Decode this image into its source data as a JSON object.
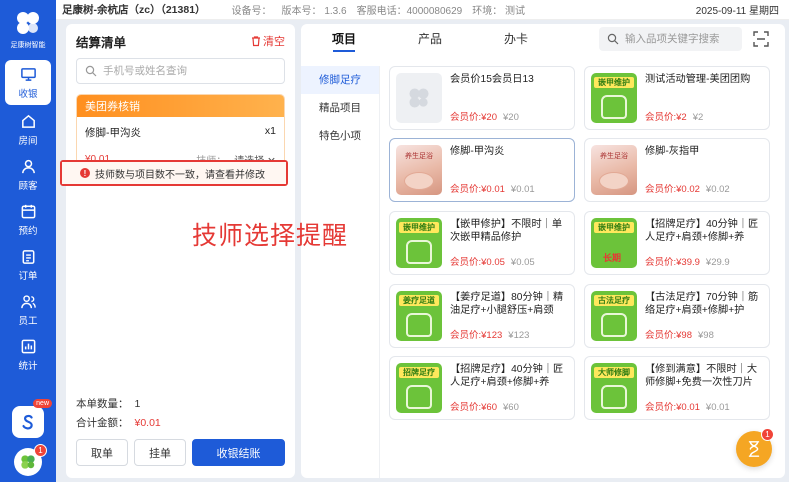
{
  "status": {
    "store": "足康树-余杭店（zc）（21381）",
    "device_label": "设备号：",
    "version": "版本号： 1.3.6",
    "hotline": "客服电话：4000080629",
    "env": "环境： 测试",
    "date": "2025-09-11 星期四"
  },
  "sidebar": {
    "logo_text": "足康树智能",
    "items": [
      {
        "label": "收银",
        "icon": "monitor-icon"
      },
      {
        "label": "房间",
        "icon": "home-icon"
      },
      {
        "label": "顾客",
        "icon": "user-icon"
      },
      {
        "label": "预约",
        "icon": "calendar-icon"
      },
      {
        "label": "订单",
        "icon": "clipboard-icon"
      },
      {
        "label": "员工",
        "icon": "group-icon"
      },
      {
        "label": "统计",
        "icon": "stats-icon"
      }
    ],
    "app_badge": "new",
    "avatar_badge": "1"
  },
  "checkout": {
    "title": "结算清单",
    "clear": "清空",
    "search_placeholder": "手机号或姓名查询",
    "coupon_title": "美团券核销",
    "item": {
      "name": "修脚-甲沟炎",
      "qty": "x1",
      "price": "¥0.01",
      "tech_label": "技师：",
      "tech_select": "请选择"
    },
    "warning": "技师数与项目数不一致，请查看并修改",
    "count_label": "本单数量：",
    "count_value": "1",
    "total_label": "合计金额：",
    "total_value": "¥0.01",
    "btn_cancel": "取单",
    "btn_hold": "挂单",
    "btn_pay": "收银结账"
  },
  "products": {
    "tabs": [
      "项目",
      "产品",
      "办卡"
    ],
    "search_placeholder": "输入品项关键字搜索",
    "categories": [
      "修脚足疗",
      "精品项目",
      "特色小项"
    ],
    "cards": [
      {
        "name": "会员价15会员日13",
        "member": "会员价:¥20",
        "orig": "¥20",
        "thumb": "gray",
        "tag": ""
      },
      {
        "name": "测试活动管理-美团团购",
        "member": "会员价:¥2",
        "orig": "¥2",
        "thumb": "green",
        "tag": "嵌甲维护"
      },
      {
        "name": "修脚-甲沟炎",
        "member": "会员价:¥0.01",
        "orig": "¥0.01",
        "thumb": "photo",
        "tag": "养生足浴"
      },
      {
        "name": "修脚-灰指甲",
        "member": "会员价:¥0.02",
        "orig": "¥0.02",
        "thumb": "photo",
        "tag": "养生足浴"
      },
      {
        "name": "【嵌甲修护】不限时｜单次嵌甲精品修护",
        "member": "会员价:¥0.05",
        "orig": "¥0.05",
        "thumb": "green",
        "tag": "嵌甲维护"
      },
      {
        "name": "【招牌足疗】40分钟｜匠人足疗+肩颈+修脚+养生...",
        "member": "会员价:¥39.9",
        "orig": "¥29.9",
        "thumb": "green",
        "tag": "嵌甲维护",
        "stamp": "长期"
      },
      {
        "name": "【姜疗足道】80分钟｜精油足疗+小腿舒压+肩颈+...",
        "member": "会员价:¥123",
        "orig": "¥123",
        "thumb": "green",
        "tag": "姜疗足道"
      },
      {
        "name": "【古法足疗】70分钟｜筋络足疗+肩颈+修脚+护足...",
        "member": "会员价:¥98",
        "orig": "¥98",
        "thumb": "green",
        "tag": "古法足疗"
      },
      {
        "name": "【招牌足疗】40分钟｜匠人足疗+肩颈+修脚+养生...",
        "member": "会员价:¥60",
        "orig": "¥60",
        "thumb": "green",
        "tag": "招牌足疗"
      },
      {
        "name": "【修到满意】不限时｜大师修脚+免费一次性刀片",
        "member": "会员价:¥0.01",
        "orig": "¥0.01",
        "thumb": "green",
        "tag": "大师修脚"
      }
    ]
  },
  "annotation": "技师选择提醒",
  "float_badge": "1",
  "colors": {
    "primary": "#1e5bd8",
    "danger": "#e53935",
    "coupon": "#ff8f1f",
    "green_thumb": "#6cc33a"
  }
}
